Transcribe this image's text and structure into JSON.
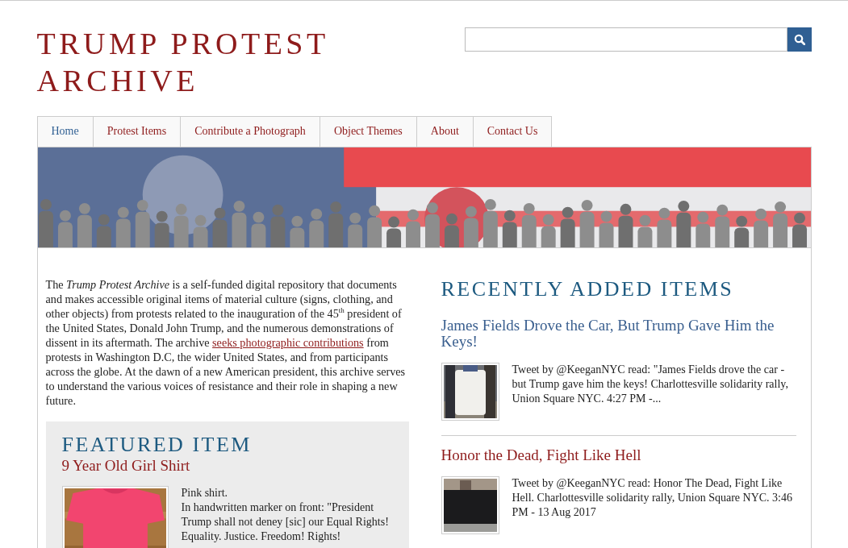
{
  "site_title": "TRUMP PROTEST ARCHIVE",
  "nav": [
    {
      "label": "Home",
      "selected": true
    },
    {
      "label": "Protest Items",
      "selected": false
    },
    {
      "label": "Contribute a Photograph",
      "selected": false
    },
    {
      "label": "Object Themes",
      "selected": false
    },
    {
      "label": "About",
      "selected": false
    },
    {
      "label": "Contact Us",
      "selected": false
    }
  ],
  "intro": {
    "before": "The *Trump Protest Archive* is a self-funded digital repository that documents and makes accessible original items of material culture (signs, clothing, and other objects) from protests related to the inauguration of the 45$^{th}$ president of the United States, Donald John Trump, and the numerous demonstrations of dissent in its aftermath. The archive",
    "link": "seeks photographic contributions",
    "after": "from protests in Washington D.C, the wider United States, and from participants across the globe. At the dawn of a new American president, this archive serves to understand the various voices of resistance and their role in shaping a new future."
  },
  "featured": {
    "heading": "FEATURED ITEM",
    "title": "9 Year Old Girl Shirt",
    "description": [
      "Pink shirt.",
      "In handwritten marker on front: \"President Trump shall not deney [sic] our Equal Rights! Equality. Justice. Freedom! Rights!"
    ]
  },
  "recent": {
    "heading": "RECENTLY ADDED ITEMS",
    "items": [
      {
        "title": "James Fields Drove the Car, But Trump Gave Him the Keys!",
        "color": "#3a5f8f",
        "text": "Tweet by @KeeganNYC read: \"James Fields drove the car - but Trump gave him the keys! Charlottesville solidarity rally, Union Square NYC. 4:27 PM -..."
      },
      {
        "title": "Honor the Dead, Fight Like Hell",
        "color": "#8e1b1b",
        "text": "Tweet by @KeeganNYC read: Honor The Dead, Fight Like Hell. Charlottesville solidarity rally, Union Square NYC. 3:46 PM - 13 Aug 2017"
      }
    ]
  }
}
